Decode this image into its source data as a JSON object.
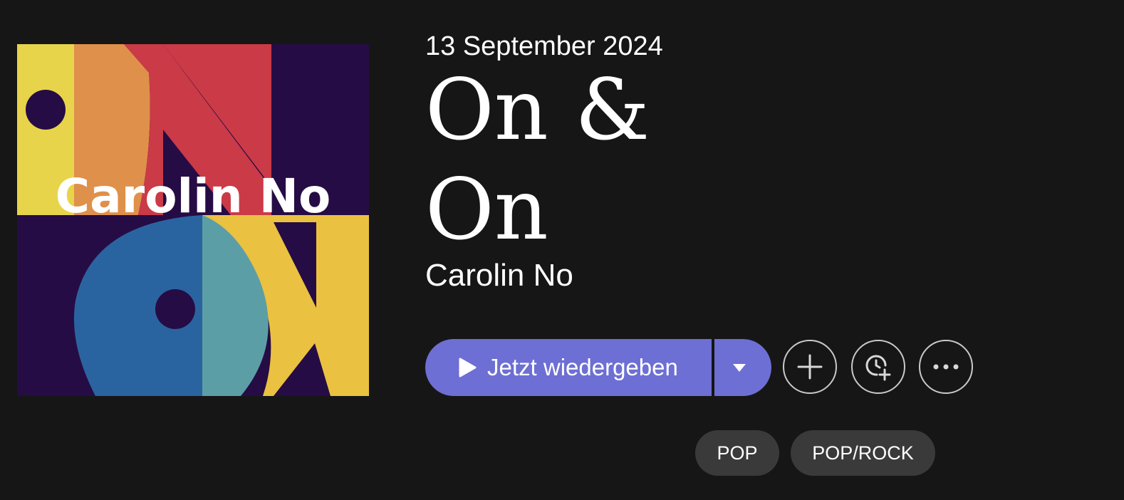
{
  "album": {
    "release_date": "13 September 2024",
    "title": "On & On",
    "artist": "Carolin No",
    "cover_text": "Carolin No"
  },
  "actions": {
    "play_label": "Jetzt wiedergeben",
    "dropdown_icon": "caret-down-icon",
    "add_icon": "plus-icon",
    "watch_later_icon": "clock-plus-icon",
    "more_icon": "more-dots-icon"
  },
  "genres": [
    "POP",
    "POP/ROCK"
  ],
  "colors": {
    "background": "#161616",
    "accent": "#6d6fd4",
    "tag_background": "#3a3a3a",
    "cover_purple": "#260c44",
    "cover_yellow": "#e8d44a",
    "cover_orange": "#df904a",
    "cover_red": "#cb3a47",
    "cover_blue": "#2a64a0",
    "cover_teal": "#5c9ea6",
    "cover_gold": "#ebc141"
  }
}
